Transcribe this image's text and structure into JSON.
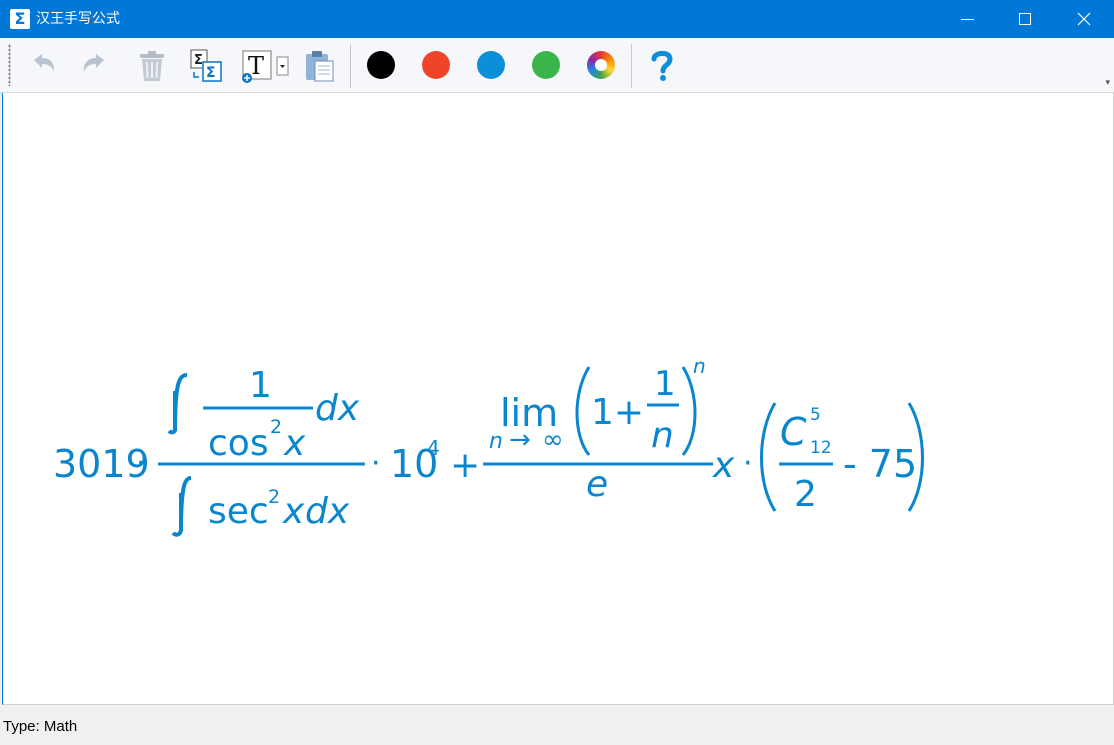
{
  "window": {
    "title": "汉王手写公式",
    "app_icon": "Σ"
  },
  "toolbar": {
    "items": [
      "undo-icon",
      "redo-icon",
      "trash-icon",
      "convert-formula-icon",
      "text-insert-icon",
      "paste-icon",
      "help-icon"
    ]
  },
  "colors": {
    "accent": "#0078d7",
    "formula": "#0a86cf",
    "palette": [
      "#000000",
      "#f0442a",
      "#0b8fd8",
      "#3ab54a"
    ]
  },
  "formula": {
    "coef": "3019",
    "dot": "·",
    "num_one": "1",
    "cos": "cos",
    "sq": "2",
    "x": "x",
    "dx": "dx",
    "sec": "sec",
    "ten": "10",
    "four": "4",
    "plus": "+",
    "lim": "lim",
    "n": "n",
    "arrow": "→",
    "inf": "∞",
    "one_plus": "1+",
    "e": "e",
    "C": "C",
    "five": "5",
    "twelve": "12",
    "two": "2",
    "minus75": "- 75"
  },
  "status": {
    "text": "Type: Math"
  }
}
